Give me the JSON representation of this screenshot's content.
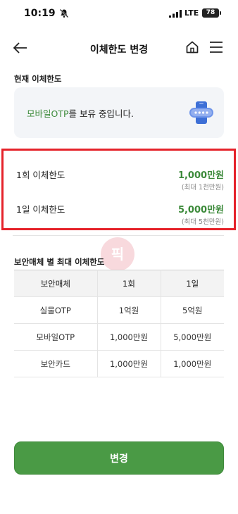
{
  "status_bar": {
    "time": "10:19",
    "network": "LTE",
    "battery": "78"
  },
  "header": {
    "title": "이체한도 변경"
  },
  "current_section": {
    "label": "현재 이체한도",
    "otp_prefix": "모바일OTP",
    "otp_suffix": "를 보유 중입니다."
  },
  "limits": [
    {
      "label": "1회 이체한도",
      "value": "1,000만원",
      "note": "(최대 1천만원)"
    },
    {
      "label": "1일 이체한도",
      "value": "5,000만원",
      "note": "(최대 5천만원)"
    }
  ],
  "watermark": "픽",
  "media_section": {
    "label": "보안매체 별 최대 이체한도",
    "headers": [
      "보안매체",
      "1회",
      "1일"
    ],
    "rows": [
      [
        "실물OTP",
        "1억원",
        "5억원"
      ],
      [
        "모바일OTP",
        "1,000만원",
        "5,000만원"
      ],
      [
        "보안카드",
        "1,000만원",
        "1,000만원"
      ]
    ]
  },
  "button": {
    "label": "변경"
  },
  "colors": {
    "accent_green": "#4a9a45",
    "value_green": "#3c8a3a",
    "highlight_red": "#e5222a"
  }
}
